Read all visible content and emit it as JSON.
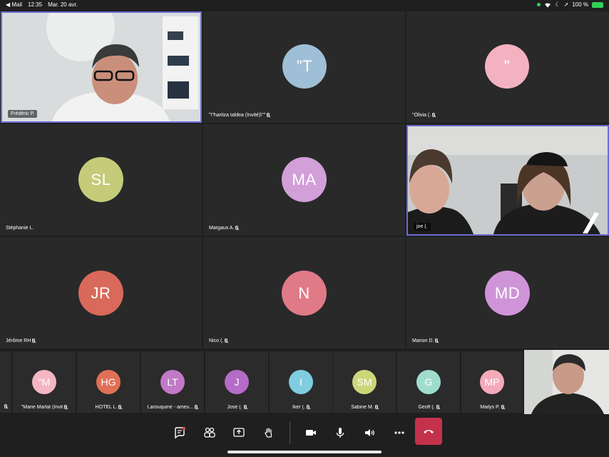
{
  "status_bar": {
    "back_app": "◀ Mail",
    "time": "12:35",
    "date": "Mar. 20 avr.",
    "battery": "100 %"
  },
  "tiles": {
    "frederic": {
      "name": "Frédéric P."
    },
    "haritza": {
      "initials": "\"T",
      "name": "\"\\\"haritza taldea (Invité)\\\"\""
    },
    "olivia": {
      "initials": "\"",
      "name": "\"Olivia (."
    },
    "stephanie": {
      "initials": "SL",
      "name": "Stéphanie L."
    },
    "margaux": {
      "initials": "MA",
      "name": "Margaux A."
    },
    "joe": {
      "name": "joe (."
    },
    "jerome": {
      "initials": "JR",
      "name": "Jérôme RH"
    },
    "nico": {
      "initials": "N",
      "name": "Nico (."
    },
    "manon": {
      "initials": "MD",
      "name": "Manon D."
    }
  },
  "strip": [
    {
      "initials": "\"M",
      "name": "\"Marie Marlat (Invit",
      "color": "#f4b6c2"
    },
    {
      "initials": "HG",
      "name": "HOTEL L.",
      "color": "#e07055"
    },
    {
      "initials": "LT",
      "name": "Larouquine - ameu...",
      "color": "#c179c8"
    },
    {
      "initials": "J",
      "name": "José (.",
      "color": "#b56cc6"
    },
    {
      "initials": "I",
      "name": "Iker (.",
      "color": "#7fcde0"
    },
    {
      "initials": "SM",
      "name": "Sabine M.",
      "color": "#ccd77a"
    },
    {
      "initials": "G",
      "name": "Geoff (.",
      "color": "#9fdccc"
    },
    {
      "initials": "MP",
      "name": "Mailys P.",
      "color": "#f4aab8"
    }
  ],
  "colors": {
    "haritza": "#9fbfd6",
    "olivia": "#f4b2c0",
    "stephanie": "#c4cc79",
    "margaux": "#d29fd8",
    "jerome": "#d9695a",
    "nico": "#e07a87",
    "manon": "#cf94d8",
    "active_border": "#6b6bd6",
    "hangup": "#c4314b"
  },
  "toolbar": {
    "icons": [
      "chat-icon",
      "participants-icon",
      "share-screen-icon",
      "raise-hand-icon",
      "camera-icon",
      "microphone-icon",
      "speaker-icon",
      "more-icon",
      "hang-up-icon"
    ]
  }
}
